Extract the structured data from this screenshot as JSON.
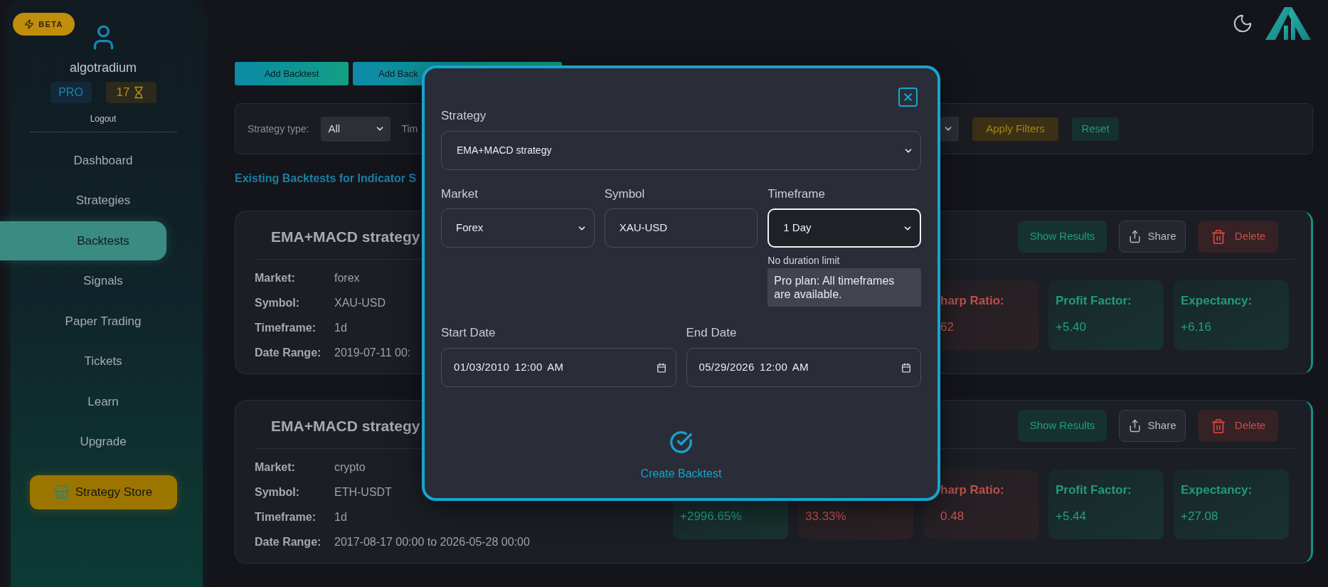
{
  "sidebar": {
    "badge": "BETA",
    "username": "algotradium",
    "plan": "PRO",
    "credits": "17",
    "logout": "Logout",
    "items": [
      {
        "label": "Dashboard",
        "selected": false
      },
      {
        "label": "Strategies",
        "selected": false
      },
      {
        "label": "Backtests",
        "selected": true
      },
      {
        "label": "Signals",
        "selected": false
      },
      {
        "label": "Paper Trading",
        "selected": false
      },
      {
        "label": "Tickets",
        "selected": false
      },
      {
        "label": "Learn",
        "selected": false
      },
      {
        "label": "Upgrade",
        "selected": false
      }
    ],
    "store_button": "Strategy Store"
  },
  "actions": [
    "Add Backtest",
    "Add Back"
  ],
  "filters": {
    "strategy_type_label": "Strategy type:",
    "strategy_type_value": "All",
    "label_2": "Tim",
    "buttons": [
      {
        "label": "Apply Filters",
        "kind": "apply"
      },
      {
        "label": "Reset",
        "kind": "reset"
      }
    ]
  },
  "section_title": "Existing Backtests for Indicator S",
  "backtests": [
    {
      "title": "EMA+MACD strategy",
      "details": [
        {
          "label": "Market:",
          "value": "forex"
        },
        {
          "label": "Symbol:",
          "value": "XAU-USD"
        },
        {
          "label": "Timeframe:",
          "value": "1d"
        },
        {
          "label": "Date Range:",
          "value": "2019-07-11 00:"
        }
      ],
      "buttons": [
        {
          "label": "Show Results",
          "kind": "results"
        },
        {
          "label": "Share",
          "kind": "share"
        },
        {
          "label": "Delete",
          "kind": "delete"
        }
      ],
      "metrics": [
        {
          "label": "harp Ratio:",
          "value": "62",
          "kind": "loss",
          "clipped": true
        },
        {
          "label": "Profit Factor:",
          "value": "+5.40",
          "kind": "gain",
          "clipped": false
        },
        {
          "label": "Expectancy:",
          "value": "+6.16",
          "kind": "gain",
          "clipped": false
        }
      ]
    },
    {
      "title": "EMA+MACD strategy",
      "details": [
        {
          "label": "Market:",
          "value": "crypto"
        },
        {
          "label": "Symbol:",
          "value": "ETH-USDT"
        },
        {
          "label": "Timeframe:",
          "value": "1d"
        },
        {
          "label": "Date Range:",
          "value": "2017-08-17 00:00 to 2026-05-28 00:00"
        }
      ],
      "buttons": [
        {
          "label": "Show Results",
          "kind": "results"
        },
        {
          "label": "Share",
          "kind": "share"
        },
        {
          "label": "Delete",
          "kind": "delete"
        }
      ],
      "metrics": [
        {
          "value": "+2996.65%",
          "kind": "gain",
          "clipped": false
        },
        {
          "value": "33.33%",
          "kind": "loss",
          "clipped": false
        },
        {
          "label": "harp Ratio:",
          "value": "0.48",
          "kind": "loss",
          "clipped": true
        },
        {
          "label": "Profit Factor:",
          "value": "+5.44",
          "kind": "gain",
          "clipped": false
        },
        {
          "label": "Expectancy:",
          "value": "+27.08",
          "kind": "gain",
          "clipped": false
        }
      ]
    }
  ],
  "modal": {
    "strategy": {
      "label": "Strategy",
      "value": "EMA+MACD strategy"
    },
    "fields": [
      {
        "label": "Market",
        "value": "Forex",
        "kind": "select",
        "focused": false
      },
      {
        "label": "Symbol",
        "value": "XAU-USD",
        "kind": "text",
        "focused": false
      },
      {
        "label": "Timeframe",
        "value": "1 Day",
        "kind": "select",
        "focused": true,
        "hint": "No duration limit",
        "note": "Pro plan: All timeframes are available."
      }
    ],
    "dates": [
      {
        "label": "Start Date",
        "value": "01/03/2010 12:00 AM"
      },
      {
        "label": "End Date",
        "value": "05/29/2026 12:00 AM"
      }
    ],
    "submit": "Create Backtest"
  }
}
